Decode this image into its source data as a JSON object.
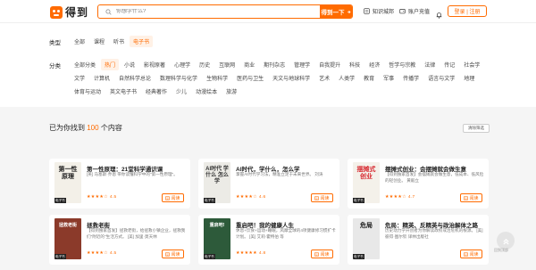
{
  "header": {
    "logo_text": "得到",
    "search_placeholder": "你想学什么?",
    "search_button": "得到一下",
    "links": [
      "知识城邦",
      "账户充值"
    ],
    "login": "登录 | 注册"
  },
  "filters": {
    "type_label": "类型",
    "types": [
      "全部",
      "课程",
      "听书",
      "电子书"
    ],
    "type_active": 3,
    "category_label": "分类",
    "categories_row1": [
      "全部分类",
      "热门",
      "小说",
      "影视原著",
      "心理学",
      "历史",
      "互联网",
      "商业",
      "期刊杂志",
      "管理学",
      "自我提升",
      "科技",
      "经济",
      "哲学与宗教",
      "法律",
      "传记",
      "社会学"
    ],
    "categories_row2": [
      "文学",
      "计算机",
      "自然科学总论",
      "数理科学与化学",
      "生物科学",
      "医药与卫生",
      "天文与地球科学",
      "艺术",
      "人类学",
      "教育",
      "军事",
      "传播学",
      "语言与文学",
      "地理"
    ],
    "categories_row3": [
      "体育与运动",
      "英文电子书",
      "经典著作",
      "少儿",
      "动漫绘本",
      "旅游"
    ],
    "category_active": 1
  },
  "results": {
    "prefix": "已为你找到",
    "count": "100",
    "suffix": "个内容",
    "clear_label": "清除筛选"
  },
  "cards": [
    {
      "title": "第一性原理：21堂科学通识课",
      "desc": "[英] 马塞斯·乔恩\n带你读懂科学中的\"第一性原理\"。",
      "rating": "4.5",
      "stars": 4.5,
      "cover_text": "第一性原理",
      "read": "阅读"
    },
    {
      "title": "AI时代，学什么，怎么学",
      "desc": "掌握AI时代学习法，精准立足于未来世界。\n刘涛",
      "rating": "4.6",
      "stars": 4.5,
      "cover_text": "AI时代 学什么 怎么学",
      "read": "阅读"
    },
    {
      "title": "摆摊式创业：会摆摊就会做生意",
      "desc": "【得到独家首发】会摆摊就会做生意，低成本、低风险的轻创业。\n黄毅立",
      "rating": "4.7",
      "stars": 4.5,
      "cover_text": "摆摊式 创业",
      "read": "阅读"
    },
    {
      "title": "拯救老街",
      "desc": "【得到独家首发】拯救老街，给拯救小镇企业，拯救我们\"附近的\"生活方式。\n[美] 加里·莫天林",
      "rating": "4.5",
      "stars": 4.5,
      "cover_text": "拯救老街",
      "read": "阅读"
    },
    {
      "title": "重启吧！我的健康人生",
      "desc": "休息+饮食+运动+睡眠，风靡全球的4项健康修习惯扩卡计划。\n[美] 艾莉·霍特伯 等",
      "rating": "4.8",
      "stars": 5,
      "cover_text": "重启吧!",
      "read": "阅读"
    },
    {
      "title": "危局：精英、反精英与政治解体之路",
      "desc": "历史动力学开创者为你解读政权或治危机的根源。\n[美] 彼得·图尔钦\n译林出版社",
      "rating": "",
      "stars": 0,
      "cover_text": "危局",
      "read": "阅读"
    }
  ],
  "ebook_tag": "电子书",
  "back_top": "回到顶部",
  "colors": {
    "accent": "#ff6b00",
    "background": "#f5f5f5"
  }
}
